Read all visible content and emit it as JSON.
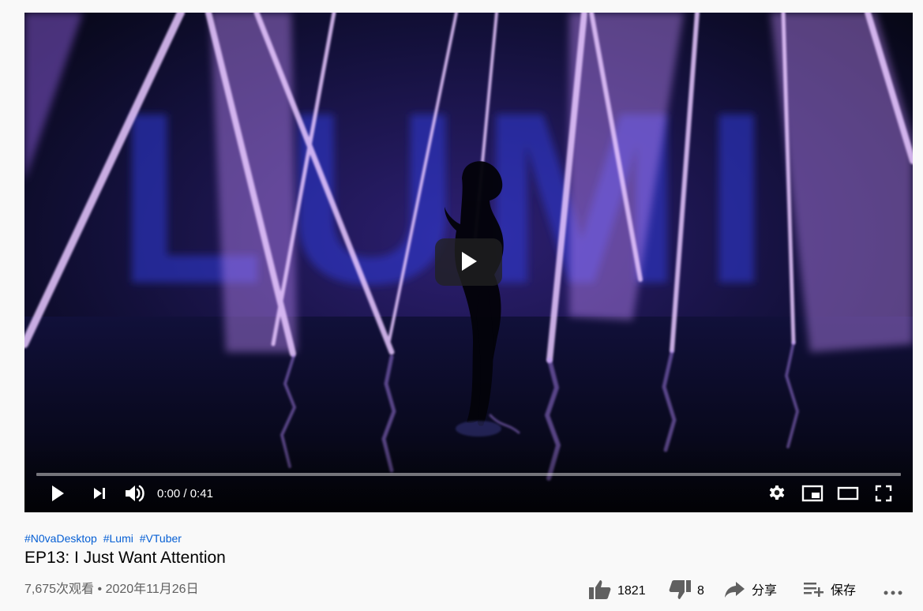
{
  "player": {
    "time_current": "0:00",
    "time_separator": " / ",
    "time_total": "0:41",
    "progress": 0,
    "video_logo_text": "LUMI",
    "colors": {
      "play_button_bg": "#212121",
      "progress_track": "#ffffff",
      "progress_fill": "#ff0000"
    }
  },
  "video": {
    "hashtags": [
      "#N0vaDesktop",
      "#Lumi",
      "#VTuber"
    ],
    "title": "EP13: I Just Want Attention",
    "views": "7,675次观看",
    "separator": "•",
    "date": "2020年11月26日"
  },
  "actions": {
    "like_count": "1821",
    "dislike_count": "8",
    "share_label": "分享",
    "save_label": "保存"
  },
  "icons": {
    "big_play": "play-icon",
    "play": "play-icon",
    "next": "next-icon",
    "volume": "volume-icon",
    "settings": "gear-icon",
    "miniplayer": "miniplayer-icon",
    "theater": "theater-mode-icon",
    "fullscreen": "fullscreen-icon",
    "like": "thumbs-up-icon",
    "dislike": "thumbs-down-icon",
    "share": "share-icon",
    "save": "playlist-add-icon",
    "more": "more-icon"
  },
  "colors": {
    "background": "#f9f9f9",
    "text_primary": "#030303",
    "text_secondary": "#606060",
    "link": "#065fd4"
  }
}
